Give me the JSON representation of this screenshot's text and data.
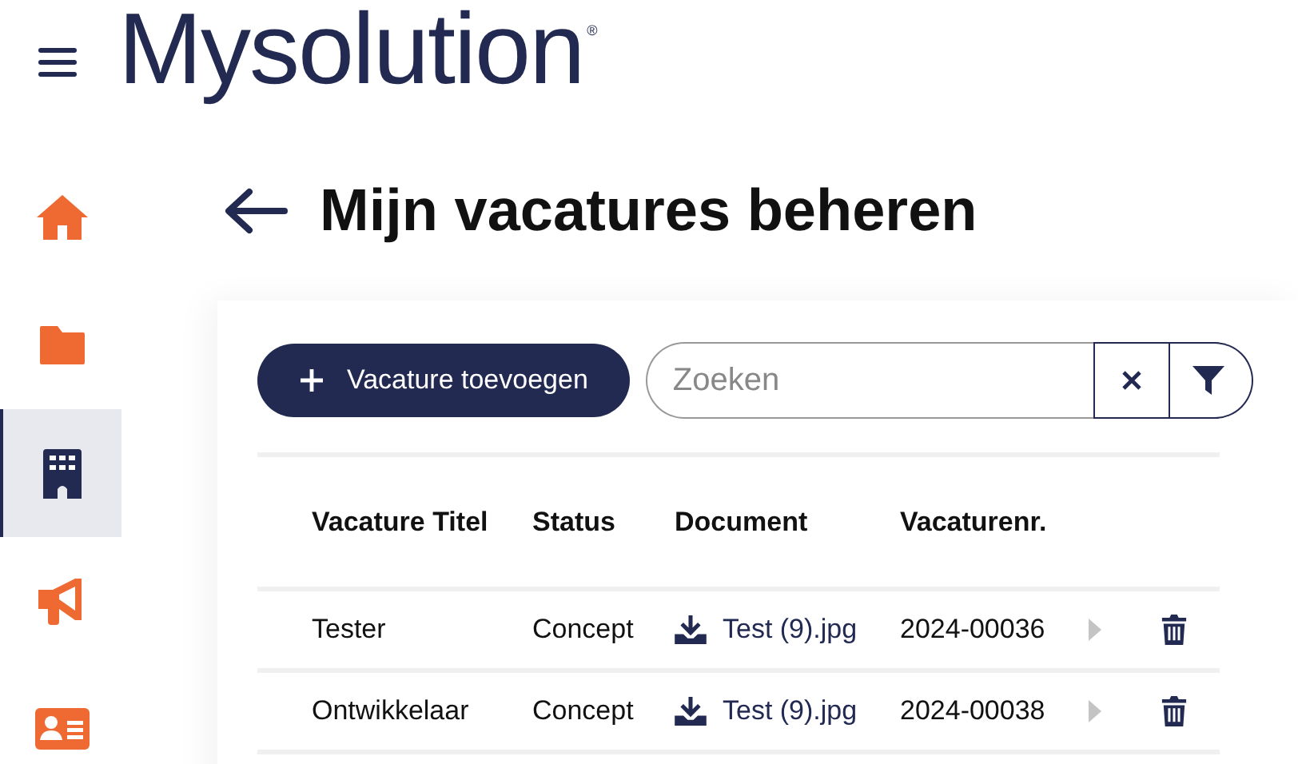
{
  "header": {
    "logo": "Mysolution",
    "logo_mark": "®"
  },
  "sidebar": {
    "items": [
      {
        "selected": false
      },
      {
        "selected": false
      },
      {
        "selected": true
      },
      {
        "selected": false
      },
      {
        "selected": false
      }
    ]
  },
  "page": {
    "title": "Mijn vacatures beheren"
  },
  "toolbar": {
    "add_button": "Vacature toevoegen",
    "search": {
      "placeholder": "Zoeken"
    }
  },
  "table": {
    "columns": [
      "Vacature Titel",
      "Status",
      "Document",
      "Vacaturenr."
    ],
    "rows": [
      {
        "title": "Tester",
        "status": "Concept",
        "document": "Test (9).jpg",
        "number": "2024-00036"
      },
      {
        "title": "Ontwikkelaar",
        "status": "Concept",
        "document": "Test (9).jpg",
        "number": "2024-00038"
      }
    ]
  }
}
